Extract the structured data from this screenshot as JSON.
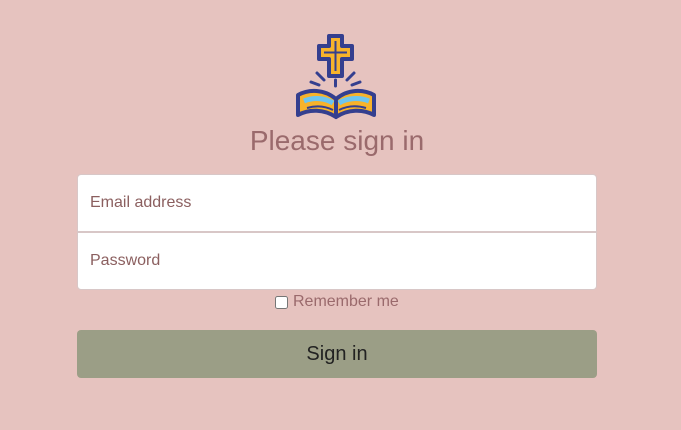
{
  "header": {
    "logo_icon": "cross-bible-icon",
    "title": "Please sign in"
  },
  "form": {
    "email_placeholder": "Email address",
    "password_placeholder": "Password",
    "remember_label": "Remember me",
    "remember_checked": false,
    "submit_label": "Sign in"
  },
  "colors": {
    "background": "#e6c3bf",
    "title": "#9a6a6c",
    "button": "#9b9e86"
  }
}
